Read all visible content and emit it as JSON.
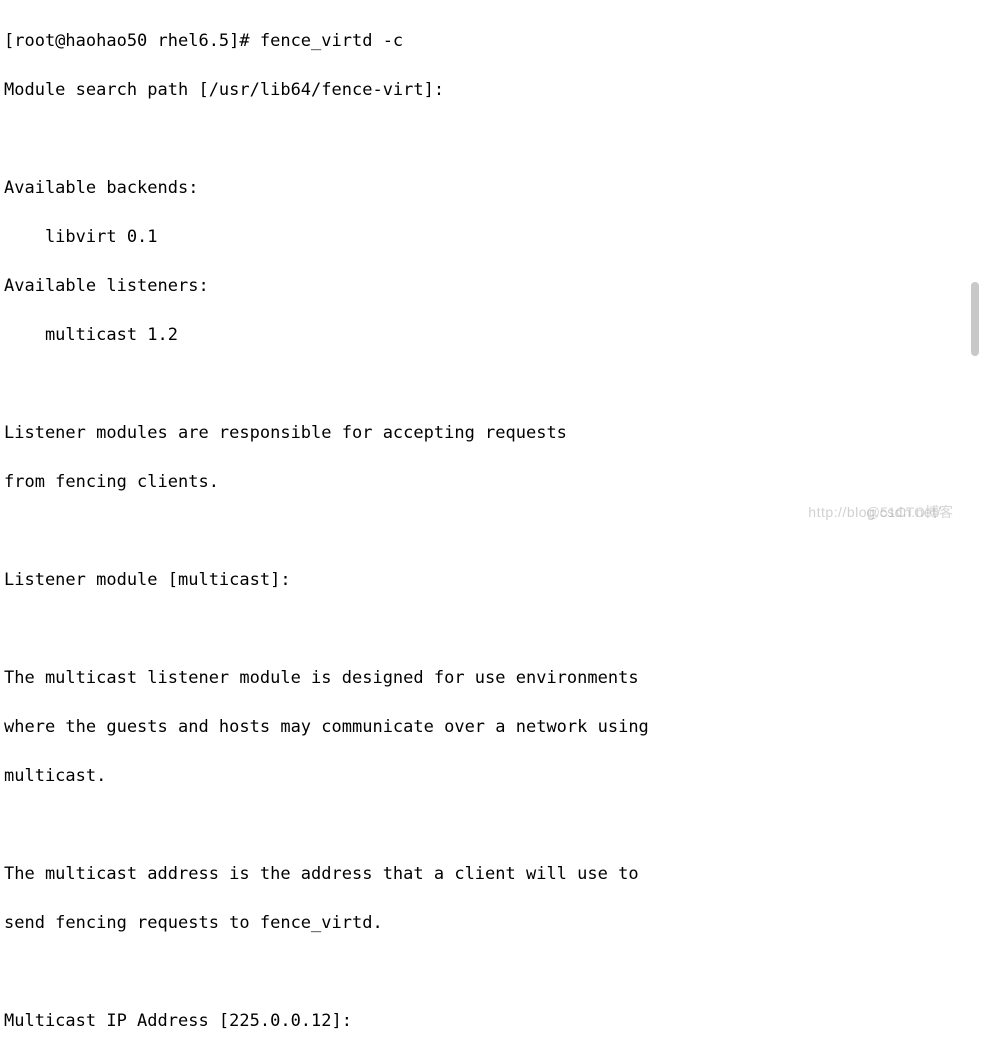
{
  "terminal": {
    "lines": [
      "[root@haohao50 rhel6.5]# fence_virtd -c",
      "Module search path [/usr/lib64/fence-virt]:",
      "",
      "Available backends:",
      "    libvirt 0.1",
      "Available listeners:",
      "    multicast 1.2",
      "",
      "Listener modules are responsible for accepting requests",
      "from fencing clients.",
      "",
      "Listener module [multicast]:",
      "",
      "The multicast listener module is designed for use environments",
      "where the guests and hosts may communicate over a network using",
      "multicast.",
      "",
      "The multicast address is the address that a client will use to",
      "send fencing requests to fence_virtd.",
      "",
      "Multicast IP Address [225.0.0.12]:"
    ]
  },
  "watermark": {
    "text1": "http://blog.csdn.net/",
    "text2": "@51CTO博客"
  }
}
